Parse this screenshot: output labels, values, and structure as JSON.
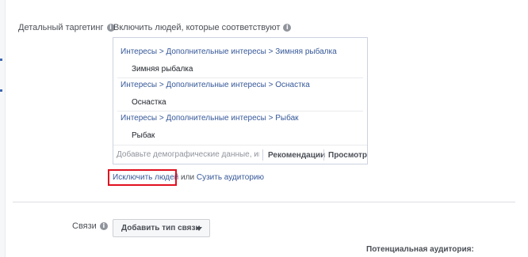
{
  "targeting": {
    "label": "Детальный таргетинг",
    "include_label": "Включить людей, которые соответствуют",
    "selections": [
      {
        "path": "Интересы > Дополнительные интересы > Зимняя рыбалка",
        "name": "Зимняя рыбалка"
      },
      {
        "path": "Интересы > Дополнительные интересы > Оснастка",
        "name": "Оснастка"
      },
      {
        "path": "Интересы > Дополнительные интересы > Рыбак",
        "name": "Рыбак"
      }
    ],
    "search_placeholder": "Добавьте демографические данные, интересы или поведение",
    "recommendations_label": "Рекомендации",
    "browse_label": "Просмотр",
    "exclude_link": "Исключить людей",
    "or_text": "или",
    "narrow_link": "Сузить аудиторию"
  },
  "connections": {
    "label": "Связи",
    "add_button": "Добавить тип связи"
  },
  "audience": {
    "label": "Потенциальная аудитория:"
  },
  "colors": {
    "link": "#365899",
    "highlight": "#e0101f",
    "border": "#cdd2e0"
  }
}
